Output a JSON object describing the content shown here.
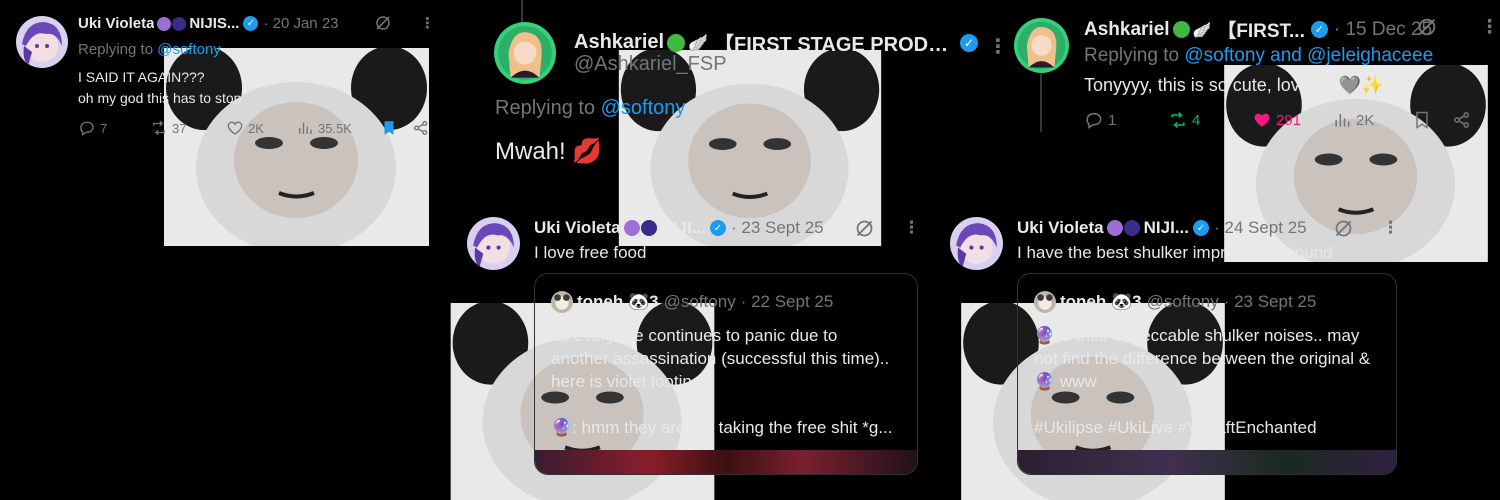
{
  "colors": {
    "bg": "#000000",
    "text": "#e7e9ea",
    "muted": "#71767b",
    "link": "#1d9bf0",
    "like_active": "#f91880",
    "repost_active": "#00ba7c"
  },
  "tweet1": {
    "name": "Uki Violeta",
    "name_suffix": "NIJIS...",
    "date": "· 20 Jan 23",
    "replying_label": "Replying to",
    "replying_handle": "@softony",
    "line1": "I SAID IT AGAIN???",
    "line2": "oh my god this has to stop",
    "replies": "7",
    "reposts": "37",
    "likes": "2K",
    "views": "35.5K"
  },
  "tweet2": {
    "name": "Ashkariel",
    "name_suffix": "【FIRST STAGE PRODUC...",
    "handle": "@Ashkariel_FSP",
    "replying_label": "Replying to",
    "replying_handle": "@softony",
    "text": "Mwah! 💋"
  },
  "tweet3": {
    "name": "Ashkariel",
    "name_suffix": "【FIRST...",
    "date": "· 15 Dec 25",
    "replying_label": "Replying to",
    "replying_handles": "@softony and @jeleighaceee",
    "text": "Tonyyyy, this is so cute, love it!! 🩶✨",
    "replies": "1",
    "reposts": "4",
    "likes": "291",
    "views": "2K"
  },
  "tweet4": {
    "name": "Uki Violeta",
    "name_suffix": "NIJI...",
    "date": "· 23 Sept 25",
    "text": "I love free food",
    "quote": {
      "name": "toneh 🐼3",
      "handle": "@softony",
      "date": "· 22 Sept 25",
      "line1": "as everyone continues to panic due to",
      "line2": "another assassination (successful this time)..",
      "line3": "here is violet looting.",
      "line4": "🔮: hmm they are not taking the free shit *g..."
    }
  },
  "tweet5": {
    "name": "Uki Violeta",
    "name_suffix": "NIJI...",
    "date": "· 24 Sept 25",
    "text": "I have the best shulker impression around",
    "quote": {
      "name": "toneh 🐼3",
      "handle": "@softony",
      "date": "· 23 Sept 25",
      "line1": "🔮 & their impeccable shulker noises.. may",
      "line2": "not find the difference between the original &",
      "line3": "🔮 www",
      "line4": "#Ukilipse #UkiLive #VCraftEnchanted"
    }
  }
}
